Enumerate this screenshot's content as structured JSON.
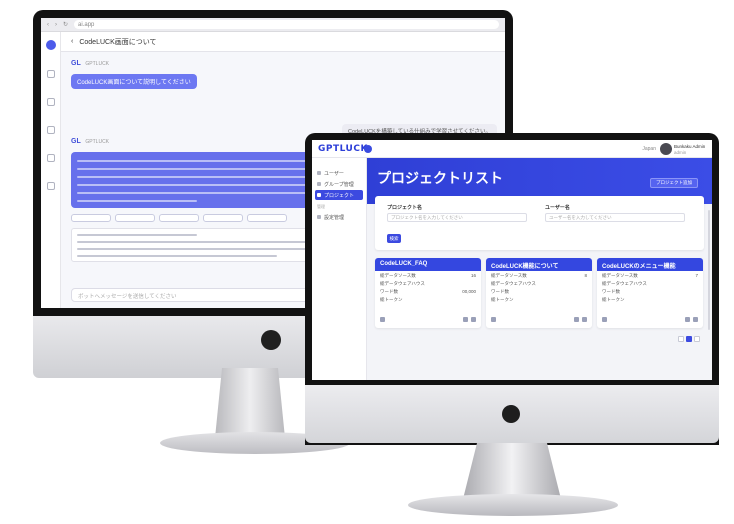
{
  "back_app": {
    "browser_url": "ai.app",
    "header_title": "CodeLUCK画面について",
    "bot_name": "GPTLUCK",
    "bot_short": "GL",
    "prompt_chip": "CodeLUCK画面について説明してください",
    "user_message": "CodeLUCKを構築している仕組みで学習させてください。",
    "input_placeholder": "ボットへメッセージを送信してください"
  },
  "front_app": {
    "logo": "GPTLUCK",
    "language": "Japan",
    "user_name": "Bunkaku Admin",
    "user_role": "admin",
    "sidebar": {
      "items": [
        {
          "label": "ユーザー"
        },
        {
          "label": "グループ管理"
        },
        {
          "label": "プロジェクト"
        }
      ],
      "group_label": "管理",
      "extra_item": "設定管理"
    },
    "page_title": "プロジェクトリスト",
    "new_button": "プロジェクト追加",
    "search": {
      "project_name_label": "プロジェクト名",
      "project_name_placeholder": "プロジェクト名を入力してください",
      "user_label": "ユーザー名",
      "user_placeholder": "ユーザー名を入力してください",
      "button": "検索"
    },
    "cards": [
      {
        "title": "CodeLUCK_FAQ",
        "rows": [
          {
            "k": "総データソース数",
            "v": "16"
          },
          {
            "k": "総データウェアハウス",
            "v": ""
          },
          {
            "k": "ワード数",
            "v": "00,000"
          },
          {
            "k": "総トークン",
            "v": ""
          }
        ]
      },
      {
        "title": "CodeLUCK機能について",
        "rows": [
          {
            "k": "総データソース数",
            "v": "8"
          },
          {
            "k": "総データウェアハウス",
            "v": ""
          },
          {
            "k": "ワード数",
            "v": ""
          },
          {
            "k": "総トークン",
            "v": ""
          }
        ]
      },
      {
        "title": "CodeLUCKのメニュー機能",
        "rows": [
          {
            "k": "総データソース数",
            "v": "7"
          },
          {
            "k": "総データウェアハウス",
            "v": ""
          },
          {
            "k": "ワード数",
            "v": ""
          },
          {
            "k": "総トークン",
            "v": ""
          }
        ]
      }
    ]
  },
  "colors": {
    "brand_blue": "#3447e0",
    "chip_purple": "#6d78f2"
  }
}
